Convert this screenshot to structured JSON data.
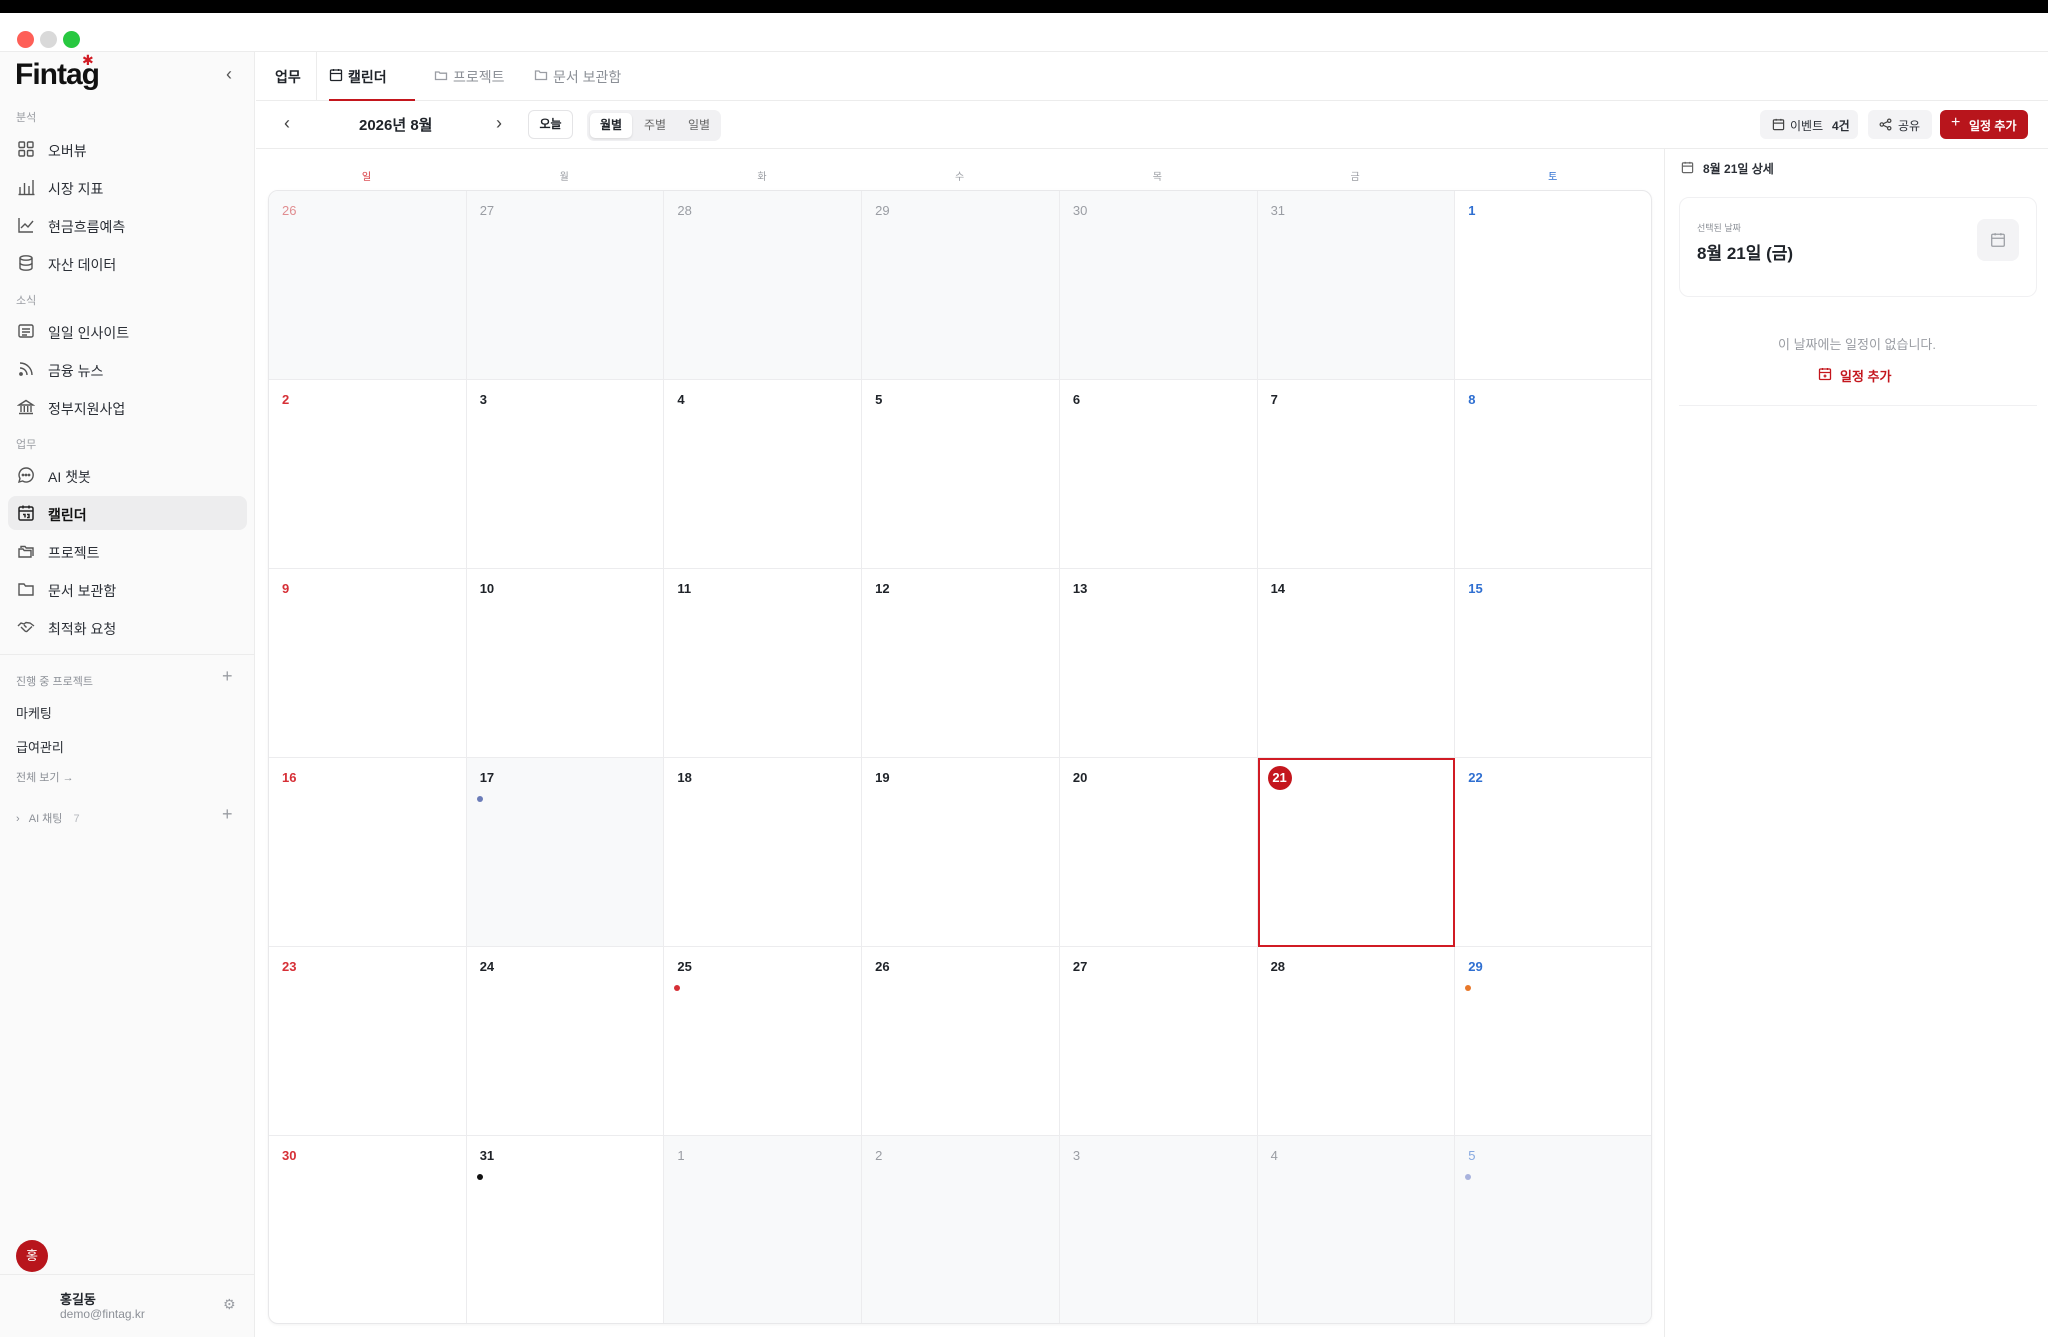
{
  "app": {
    "logo": "Fintag"
  },
  "sidebar": {
    "sections": [
      {
        "label": "분석",
        "items": [
          {
            "label": "오버뷰",
            "icon": "grid-icon"
          },
          {
            "label": "시장 지표",
            "icon": "bar-chart-icon"
          },
          {
            "label": "현금흐름예측",
            "icon": "line-chart-icon"
          },
          {
            "label": "자산 데이터",
            "icon": "database-icon"
          }
        ]
      },
      {
        "label": "소식",
        "items": [
          {
            "label": "일일 인사이트",
            "icon": "newspaper-icon"
          },
          {
            "label": "금융 뉴스",
            "icon": "rss-icon"
          },
          {
            "label": "정부지원사업",
            "icon": "bank-icon"
          }
        ]
      },
      {
        "label": "업무",
        "items": [
          {
            "label": "AI 챗봇",
            "icon": "chat-icon"
          },
          {
            "label": "캘린더",
            "icon": "calendar-icon",
            "active": true
          },
          {
            "label": "프로젝트",
            "icon": "folders-icon"
          },
          {
            "label": "문서 보관함",
            "icon": "folder-icon"
          },
          {
            "label": "최적화 요청",
            "icon": "handshake-icon"
          }
        ]
      }
    ],
    "projects": {
      "label": "진행 중 프로젝트",
      "items": [
        "마케팅",
        "급여관리"
      ],
      "view_all": "전체 보기 →"
    },
    "ai_chat": {
      "label": "AI 채팅",
      "count": "7"
    },
    "user": {
      "initial": "홍",
      "name": "홍길동",
      "email": "demo@fintag.kr"
    }
  },
  "tabs": {
    "section": "업무",
    "items": [
      {
        "label": "캘린더",
        "icon": "calendar-icon",
        "active": true
      },
      {
        "label": "프로젝트",
        "icon": "folders-icon"
      },
      {
        "label": "문서 보관함",
        "icon": "folder-icon"
      }
    ]
  },
  "toolbar": {
    "month": "2026년 8월",
    "today": "오늘",
    "views": [
      "월별",
      "주별",
      "일별"
    ],
    "active_view": "월별",
    "events_label": "이벤트",
    "events_count": "4건",
    "share": "공유",
    "add": "일정 추가"
  },
  "calendar": {
    "weekdays": [
      "일",
      "월",
      "화",
      "수",
      "목",
      "금",
      "토"
    ],
    "weeks": [
      [
        {
          "d": "26",
          "o": true
        },
        {
          "d": "27",
          "o": true
        },
        {
          "d": "28",
          "o": true
        },
        {
          "d": "29",
          "o": true
        },
        {
          "d": "30",
          "o": true
        },
        {
          "d": "31",
          "o": true
        },
        {
          "d": "1"
        }
      ],
      [
        {
          "d": "2"
        },
        {
          "d": "3"
        },
        {
          "d": "4"
        },
        {
          "d": "5"
        },
        {
          "d": "6"
        },
        {
          "d": "7"
        },
        {
          "d": "8"
        }
      ],
      [
        {
          "d": "9"
        },
        {
          "d": "10"
        },
        {
          "d": "11"
        },
        {
          "d": "12"
        },
        {
          "d": "13"
        },
        {
          "d": "14"
        },
        {
          "d": "15"
        }
      ],
      [
        {
          "d": "16"
        },
        {
          "d": "17",
          "shaded": true,
          "dot": "#6b7cb8"
        },
        {
          "d": "18"
        },
        {
          "d": "19"
        },
        {
          "d": "20"
        },
        {
          "d": "21",
          "selected": true
        },
        {
          "d": "22"
        }
      ],
      [
        {
          "d": "23"
        },
        {
          "d": "24"
        },
        {
          "d": "25",
          "dot": "#d62f36"
        },
        {
          "d": "26"
        },
        {
          "d": "27"
        },
        {
          "d": "28"
        },
        {
          "d": "29",
          "dot": "#e8782a"
        }
      ],
      [
        {
          "d": "30"
        },
        {
          "d": "31",
          "dot": "#111111"
        },
        {
          "d": "1",
          "o": true
        },
        {
          "d": "2",
          "o": true
        },
        {
          "d": "3",
          "o": true
        },
        {
          "d": "4",
          "o": true
        },
        {
          "d": "5",
          "o": true,
          "dot": "#a9b3dd"
        }
      ]
    ]
  },
  "detail": {
    "title": "8월 21일 상세",
    "selected_label": "선택된 날짜",
    "selected_date": "8월 21일 (금)",
    "empty": "이 날짜에는 일정이 없습니다.",
    "add": "일정 추가"
  },
  "colors": {
    "accent": "#c4161d",
    "sunday": "#d62f36",
    "saturday": "#2f6fd1"
  }
}
